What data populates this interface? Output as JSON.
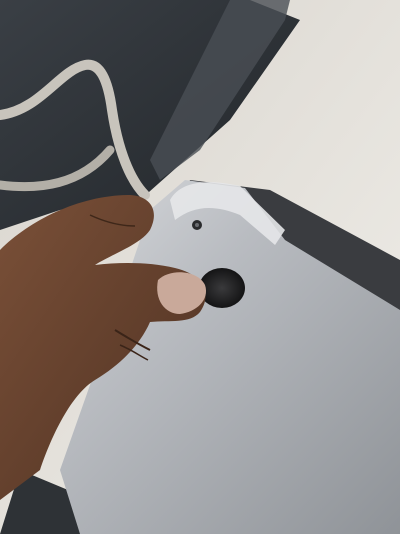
{
  "photo": {
    "subject_icons": [
      "laptop-bottom-case",
      "rubber-foot",
      "screw",
      "hand",
      "chair"
    ],
    "colors": {
      "floor": "#e9e6e0",
      "chair_seat": "#2d3136",
      "chair_frame": "#b9b5ad",
      "laptop_case": "#b5b8bc",
      "laptop_edge": "#3a3c40",
      "skin": "#6b4632",
      "rubber_foot": "#1e1e1f"
    }
  }
}
